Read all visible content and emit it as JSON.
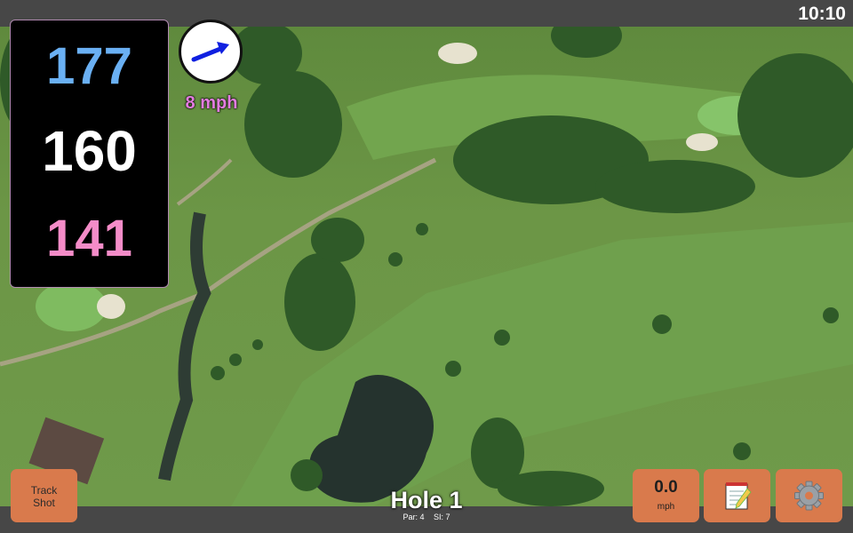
{
  "status_bar": {
    "time": "10:10"
  },
  "distances": {
    "back": "177",
    "middle": "160",
    "front": "141",
    "colors": {
      "back": "#6ab0f3",
      "middle": "#ffffff",
      "front": "#f48cc8"
    }
  },
  "wind": {
    "speed": "8 mph",
    "arrow_color": "#1020e0",
    "icon": "wind-direction-arrow"
  },
  "hole": {
    "title": "Hole 1",
    "par": "Par: 4",
    "stroke_index": "SI: 7"
  },
  "buttons": {
    "track_shot_line1": "Track",
    "track_shot_line2": "Shot",
    "speed_value": "0.0",
    "speed_unit": "mph",
    "notes_icon": "notepad-icon",
    "settings_icon": "gear-icon"
  }
}
